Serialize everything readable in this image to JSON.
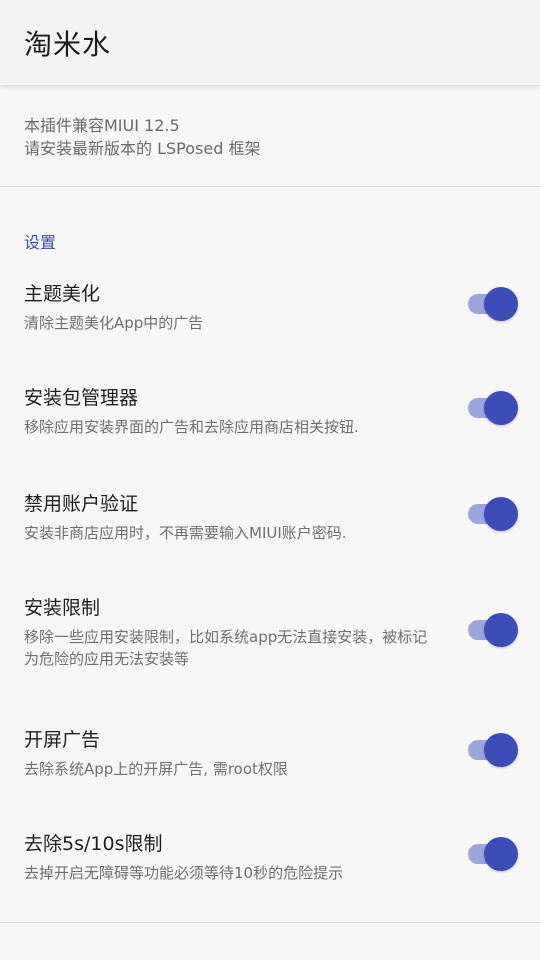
{
  "appbar": {
    "title": "淘米水"
  },
  "info": {
    "line1": "本插件兼容MIUI 12.5",
    "line2": "请安装最新版本的 LSPosed 框架"
  },
  "section": {
    "title": "设置"
  },
  "settings": [
    {
      "title": "主题美化",
      "desc": "清除主题美化App中的广告",
      "enabled": true
    },
    {
      "title": "安装包管理器",
      "desc": "移除应用安装界面的广告和去除应用商店相关按钮.",
      "enabled": true
    },
    {
      "title": "禁用账户验证",
      "desc": "安装非商店应用时，不再需要输入MIUI账户密码.",
      "enabled": true
    },
    {
      "title": "安装限制",
      "desc": "移除一些应用安装限制，比如系统app无法直接安装，被标记为危险的应用无法安装等",
      "enabled": true
    },
    {
      "title": "开屏广告",
      "desc": "去除系统App上的开屏广告, 需root权限",
      "enabled": true
    },
    {
      "title": "去除5s/10s限制",
      "desc": "去掉开启无障碍等功能必须等待10秒的危险提示",
      "enabled": true
    }
  ],
  "colors": {
    "accent": "#3d4db8",
    "track": "#9aa6dc",
    "section": "#3a4fa3"
  }
}
